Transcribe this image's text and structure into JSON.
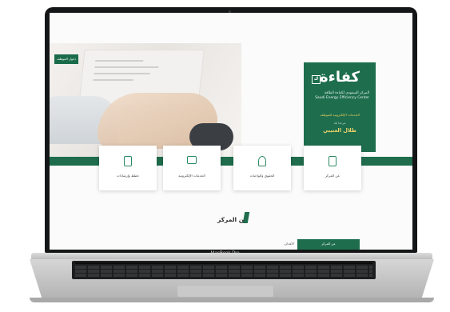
{
  "device": {
    "model_label": "MacBook Pro"
  },
  "site": {
    "logo": {
      "word": "كفاءة",
      "badge": "ك",
      "subtitle_ar": "المركز السعودي لكفاءة الطاقة",
      "subtitle_en": "Saudi Energy Efficiency Center",
      "tagline": "الخدمات الإلكترونية للموظف",
      "tagline2": "مرحبا بك",
      "user_name": "طلال العتيبي"
    },
    "hero_cta": "دخول الموظف",
    "cards": [
      {
        "label": "عن المركز",
        "icon": "document-icon"
      },
      {
        "label": "الحقوق والواجبات",
        "icon": "user-icon"
      },
      {
        "label": "الخدمات الإلكترونية",
        "icon": "monitor-icon"
      },
      {
        "label": "خطط وإرشادات",
        "icon": "tablet-icon"
      }
    ],
    "section_title": "عن المركز",
    "bottom_tab": "عن المركز",
    "bottom_small": "الأهداف"
  },
  "colors": {
    "brand_green": "#1e6e4e",
    "accent_gold": "#e1c85b"
  }
}
